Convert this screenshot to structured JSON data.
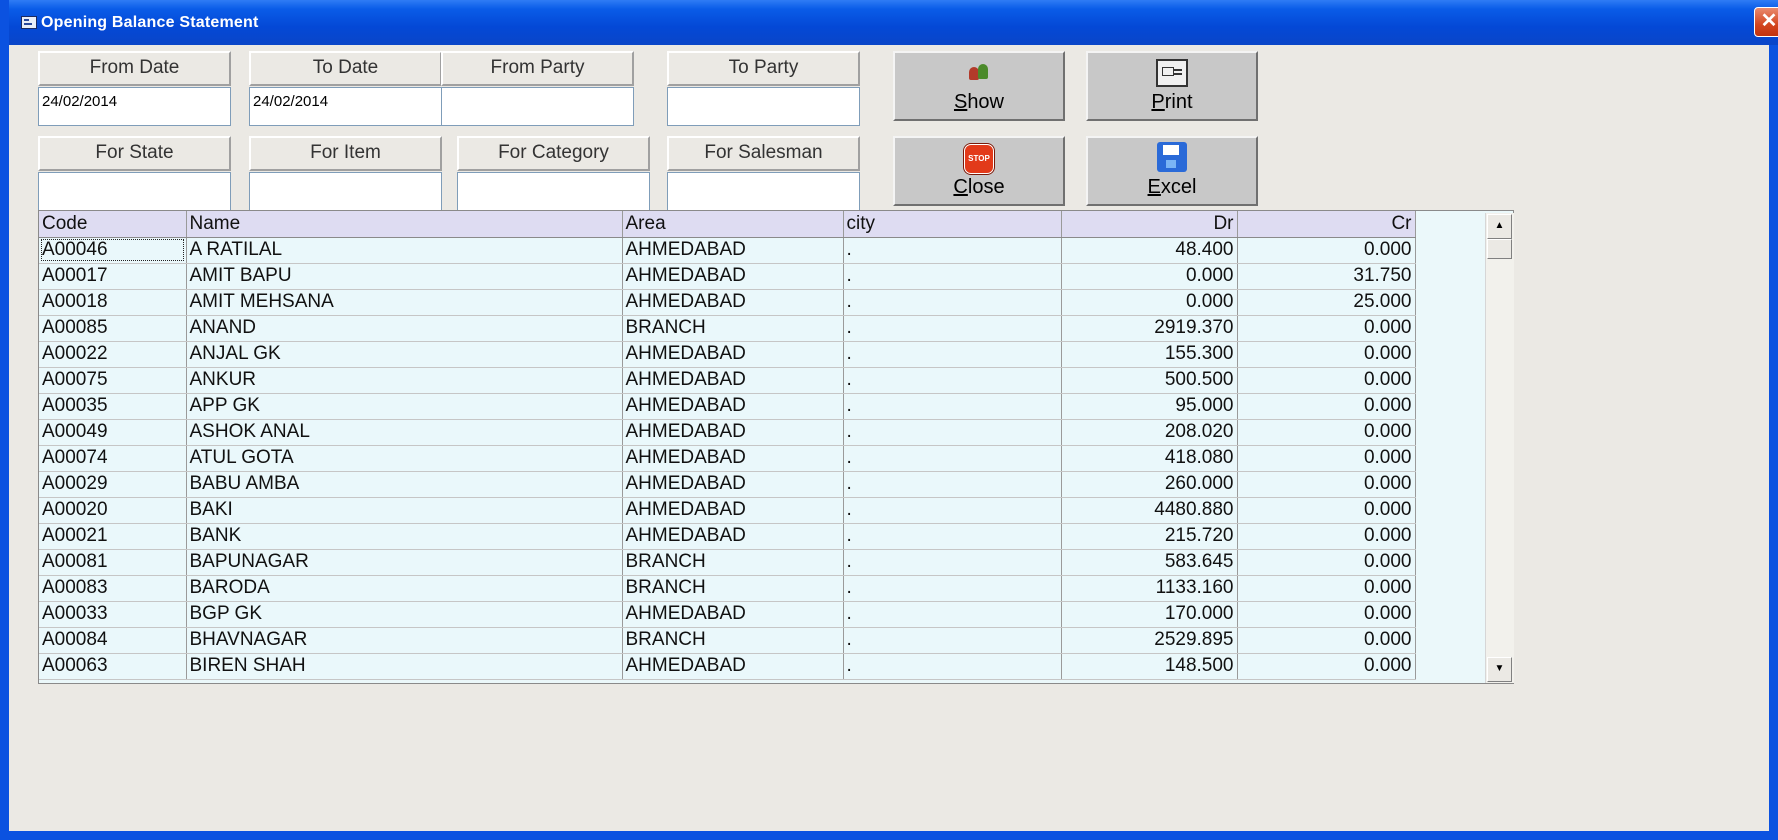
{
  "window": {
    "title": "Opening Balance Statement",
    "close_glyph": "✕"
  },
  "filters": {
    "from_date": {
      "label": "From Date",
      "value": "24/02/2014"
    },
    "to_date": {
      "label": "To Date",
      "value": "24/02/2014"
    },
    "from_party": {
      "label": "From Party",
      "value": ""
    },
    "to_party": {
      "label": "To Party",
      "value": ""
    },
    "for_state": {
      "label": "For State",
      "value": ""
    },
    "for_item": {
      "label": "For Item",
      "value": ""
    },
    "for_category": {
      "label": "For Category",
      "value": ""
    },
    "for_salesman": {
      "label": "For Salesman",
      "value": ""
    }
  },
  "buttons": {
    "show": {
      "mnemonic": "S",
      "rest": "how",
      "icon": "people-icon"
    },
    "print": {
      "mnemonic": "P",
      "rest": "rint",
      "icon": "printer-icon"
    },
    "close": {
      "mnemonic": "C",
      "rest": "lose",
      "icon": "stop-sign-icon",
      "icon_text": "STOP"
    },
    "excel": {
      "mnemonic": "E",
      "rest": "xcel",
      "icon": "floppy-disk-icon"
    }
  },
  "table": {
    "headers": {
      "code": "Code",
      "name": "Name",
      "area": "Area",
      "city": "city",
      "dr": "Dr",
      "cr": "Cr"
    },
    "rows": [
      {
        "code": "A00046",
        "name": "A RATILAL",
        "area": "AHMEDABAD",
        "city": ".",
        "dr": "48.400",
        "cr": "0.000"
      },
      {
        "code": "A00017",
        "name": "AMIT BAPU",
        "area": "AHMEDABAD",
        "city": ".",
        "dr": "0.000",
        "cr": "31.750"
      },
      {
        "code": "A00018",
        "name": "AMIT MEHSANA",
        "area": "AHMEDABAD",
        "city": ".",
        "dr": "0.000",
        "cr": "25.000"
      },
      {
        "code": "A00085",
        "name": "ANAND",
        "area": "BRANCH",
        "city": ".",
        "dr": "2919.370",
        "cr": "0.000"
      },
      {
        "code": "A00022",
        "name": "ANJAL GK",
        "area": "AHMEDABAD",
        "city": ".",
        "dr": "155.300",
        "cr": "0.000"
      },
      {
        "code": "A00075",
        "name": "ANKUR",
        "area": "AHMEDABAD",
        "city": ".",
        "dr": "500.500",
        "cr": "0.000"
      },
      {
        "code": "A00035",
        "name": "APP GK",
        "area": "AHMEDABAD",
        "city": ".",
        "dr": "95.000",
        "cr": "0.000"
      },
      {
        "code": "A00049",
        "name": "ASHOK ANAL",
        "area": "AHMEDABAD",
        "city": ".",
        "dr": "208.020",
        "cr": "0.000"
      },
      {
        "code": "A00074",
        "name": "ATUL GOTA",
        "area": "AHMEDABAD",
        "city": ".",
        "dr": "418.080",
        "cr": "0.000"
      },
      {
        "code": "A00029",
        "name": "BABU AMBA",
        "area": "AHMEDABAD",
        "city": ".",
        "dr": "260.000",
        "cr": "0.000"
      },
      {
        "code": "A00020",
        "name": "BAKI",
        "area": "AHMEDABAD",
        "city": ".",
        "dr": "4480.880",
        "cr": "0.000"
      },
      {
        "code": "A00021",
        "name": "BANK",
        "area": "AHMEDABAD",
        "city": ".",
        "dr": "215.720",
        "cr": "0.000"
      },
      {
        "code": "A00081",
        "name": "BAPUNAGAR",
        "area": "BRANCH",
        "city": ".",
        "dr": "583.645",
        "cr": "0.000"
      },
      {
        "code": "A00083",
        "name": "BARODA",
        "area": "BRANCH",
        "city": ".",
        "dr": "1133.160",
        "cr": "0.000"
      },
      {
        "code": "A00033",
        "name": "BGP GK",
        "area": "AHMEDABAD",
        "city": ".",
        "dr": "170.000",
        "cr": "0.000"
      },
      {
        "code": "A00084",
        "name": "BHAVNAGAR",
        "area": "BRANCH",
        "city": ".",
        "dr": "2529.895",
        "cr": "0.000"
      },
      {
        "code": "A00063",
        "name": "BIREN SHAH",
        "area": "AHMEDABAD",
        "city": ".",
        "dr": "148.500",
        "cr": "0.000"
      }
    ]
  },
  "scrollbar": {
    "up_glyph": "▲",
    "down_glyph": "▼"
  }
}
